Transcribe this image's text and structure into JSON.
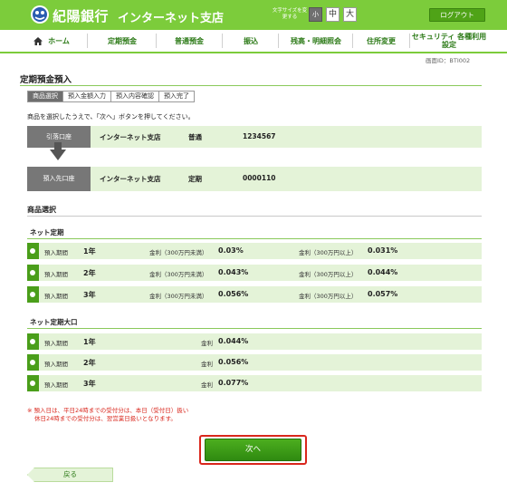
{
  "header": {
    "bank_name": "紀陽銀行",
    "branch_name": "インターネット支店",
    "font_size_label": "文字サイズを変更する",
    "font_sizes": [
      "小",
      "中",
      "大"
    ],
    "logout_label": "ログアウト",
    "brand_color": "#7ccc3b"
  },
  "nav": {
    "items": [
      "ホーム",
      "定期預金",
      "普通預金",
      "振込",
      "残高・明細照会",
      "住所変更",
      "セキュリティ 各種利用設定"
    ]
  },
  "screen_id": "画面ID：BTI002",
  "page": {
    "title": "定期預金預入",
    "steps": [
      "商品選択",
      "預入金額入力",
      "預入内容確認",
      "預入完了"
    ],
    "instruction": "商品を選択したうえで、「次へ」ボタンを押してください。"
  },
  "accounts": {
    "withdraw": {
      "label": "引落口座",
      "branch": "インターネット支店",
      "type": "普通",
      "number": "1234567"
    },
    "deposit": {
      "label": "預入先口座",
      "branch": "インターネット支店",
      "type": "定期",
      "number": "0000110"
    }
  },
  "products": {
    "section_title": "商品選択",
    "net_teiki": {
      "title": "ネット定期",
      "rows": [
        {
          "term_label": "預入期間",
          "term": "1年",
          "rate1_label": "金利（300万円未満）",
          "rate1": "0.03%",
          "rate2_label": "金利（300万円以上）",
          "rate2": "0.031%"
        },
        {
          "term_label": "預入期間",
          "term": "2年",
          "rate1_label": "金利（300万円未満）",
          "rate1": "0.043%",
          "rate2_label": "金利（300万円以上）",
          "rate2": "0.044%"
        },
        {
          "term_label": "預入期間",
          "term": "3年",
          "rate1_label": "金利（300万円未満）",
          "rate1": "0.056%",
          "rate2_label": "金利（300万円以上）",
          "rate2": "0.057%"
        }
      ]
    },
    "net_teiki_ooguchi": {
      "title": "ネット定期大口",
      "rows": [
        {
          "term_label": "預入期間",
          "term": "1年",
          "rate_label": "金利",
          "rate": "0.044%"
        },
        {
          "term_label": "預入期間",
          "term": "2年",
          "rate_label": "金利",
          "rate": "0.056%"
        },
        {
          "term_label": "預入期間",
          "term": "3年",
          "rate_label": "金利",
          "rate": "0.077%"
        }
      ]
    }
  },
  "notes": {
    "line1": "※ 預入日は、平日24時までの受付分は、本日（受付日）扱い",
    "line2": "休日24時までの受付分は、翌営業日扱いとなります。"
  },
  "buttons": {
    "next": "次へ",
    "back": "戻る"
  }
}
